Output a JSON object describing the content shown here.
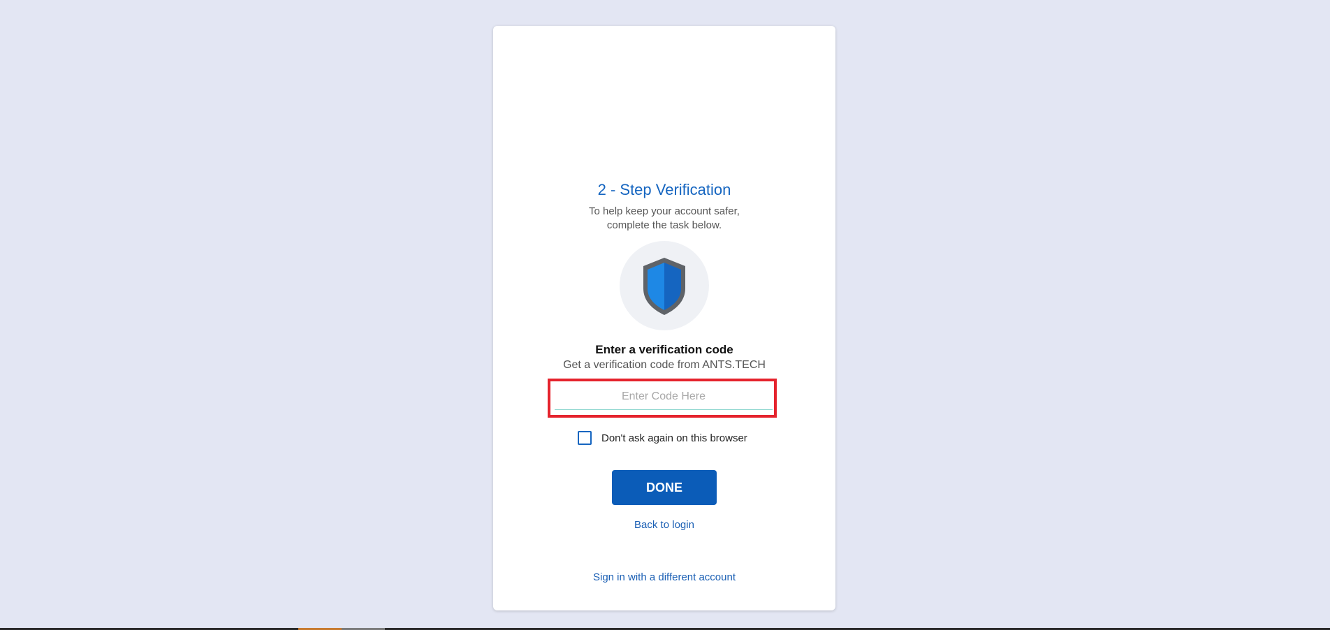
{
  "page": {
    "title": "2 - Step Verification",
    "subtitle_line1": "To help keep your account safer,",
    "subtitle_line2": "complete the task below."
  },
  "verification": {
    "heading": "Enter a verification code",
    "description": "Get a verification code from ANTS.TECH",
    "input_placeholder": "Enter Code Here",
    "input_value": "",
    "remember_label": "Don't ask again on this browser",
    "remember_checked": false
  },
  "actions": {
    "done_label": "DONE",
    "back_label": "Back to login",
    "switch_account_label": "Sign in with a different account"
  },
  "colors": {
    "background": "#e3e6f3",
    "accent": "#1565c0",
    "button": "#0b5cb8",
    "highlight_border": "#e5232d"
  },
  "icons": {
    "shield": "shield-icon"
  }
}
